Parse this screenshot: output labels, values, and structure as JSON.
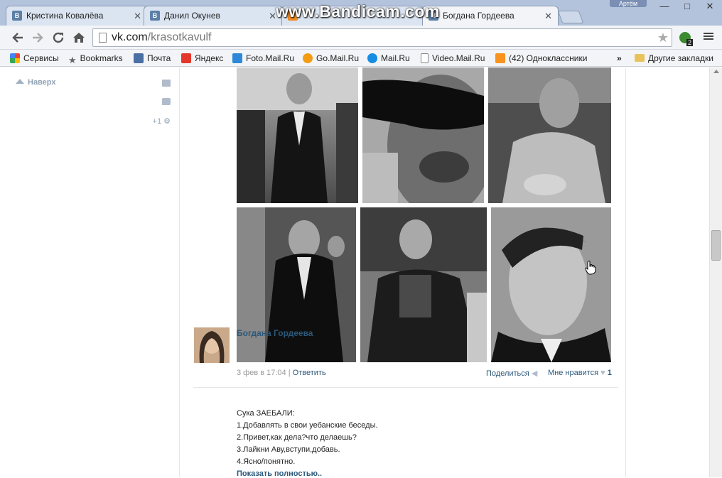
{
  "tabs": [
    {
      "label": "Кристина Ковалёва",
      "favicon": "В"
    },
    {
      "label": "Данил Окунев",
      "favicon": "В"
    },
    {
      "label": "",
      "favicon": ""
    },
    {
      "label": "Богдана Гордеева",
      "favicon": "В"
    }
  ],
  "watermark": "www.Bandicam.com",
  "user_badge": "Артём",
  "window_controls": {
    "minimize": "—",
    "maximize": "□",
    "close": "✕"
  },
  "toolbar": {
    "back_icon": "back-arrow-icon",
    "forward_icon": "forward-arrow-icon",
    "reload_icon": "reload-icon",
    "home_icon": "home-icon",
    "url_host": "vk.com",
    "url_path": "/krasotkavulf",
    "extension_count": "2"
  },
  "bookmarks": [
    {
      "label": "Сервисы",
      "icon": "apps-grid-icon",
      "color": "#e94235"
    },
    {
      "label": "Bookmarks",
      "icon": "star-icon",
      "color": "#666666"
    },
    {
      "label": "Почта",
      "icon": "mail-icon",
      "color": "#4a6fa5"
    },
    {
      "label": "Яндекс",
      "icon": "yandex-icon",
      "color": "#e5372b"
    },
    {
      "label": "Foto.Mail.Ru",
      "icon": "foto-mail-icon",
      "color": "#2d88d7"
    },
    {
      "label": "Go.Mail.Ru",
      "icon": "go-mail-icon",
      "color": "#f39c12"
    },
    {
      "label": "Mail.Ru",
      "icon": "mailru-icon",
      "color": "#168de2"
    },
    {
      "label": "Video.Mail.Ru",
      "icon": "page-icon",
      "color": "#ffffff"
    },
    {
      "label": "(42) Одноклассники",
      "icon": "ok-icon",
      "color": "#f7931e"
    }
  ],
  "bookmarks_overflow": "»",
  "other_bookmarks": "Другие закладки",
  "sidebar": {
    "to_top": "Наверх",
    "counter": "+1"
  },
  "post1": {
    "date": "3 фев в 17:04",
    "separator": "|",
    "reply": "Ответить",
    "share": "Поделиться",
    "like": "Мне нравится",
    "like_count": "1"
  },
  "post2": {
    "author": "Богдана Гордеева",
    "lines": [
      "Сука ЗАЕБАЛИ:",
      "1.Добавлять в свои уебанские беседы.",
      "2.Привет,как дела?что делаешь?",
      "3.Лайкни Аву,вступи,добавь.",
      "4.Ясно/понятно."
    ],
    "show_more": "Показать полностью.."
  }
}
